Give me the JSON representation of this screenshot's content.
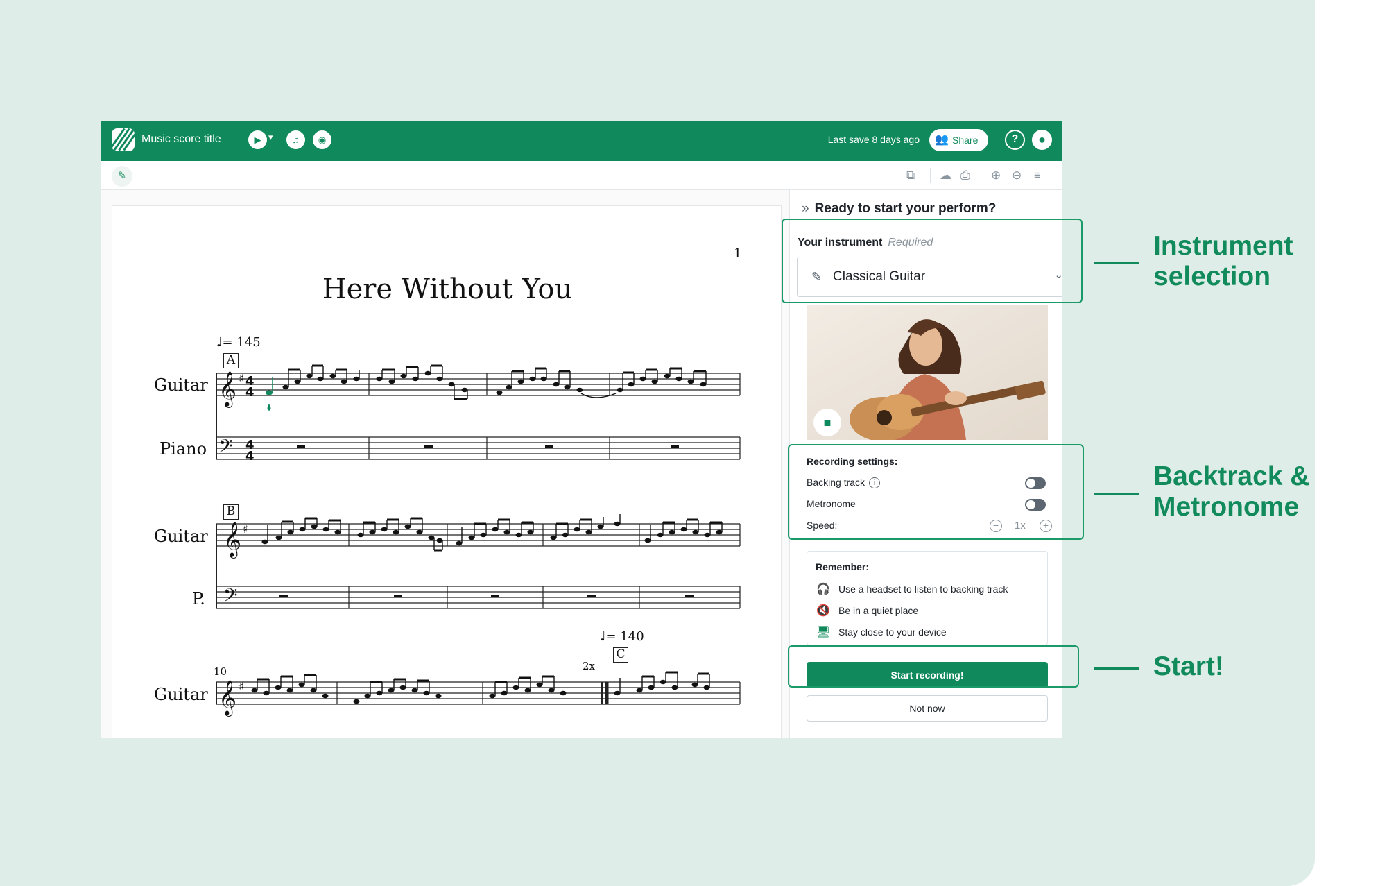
{
  "app": {
    "score_title": "Music score title",
    "last_save": "Last save 8 days ago",
    "share_label": "Share"
  },
  "score": {
    "page_number": "1",
    "song_title": "Here Without You",
    "tempo_1": "= 145",
    "tempo_2": "= 140",
    "rehearsal_a": "A",
    "rehearsal_b": "B",
    "rehearsal_c": "C",
    "instrument_guitar": "Guitar",
    "instrument_piano": "Piano",
    "instrument_piano_short": "P.",
    "measure_number": "10",
    "repeat_mark": "2x"
  },
  "panel": {
    "heading": "Ready to start your perform?",
    "instrument_label": "Your instrument",
    "required_label": "Required",
    "selected_instrument": "Classical Guitar",
    "settings_title": "Recording settings:",
    "backing_track": "Backing track",
    "metronome": "Metronome",
    "speed": "Speed:",
    "speed_value": "1x",
    "backing_track_on": false,
    "metronome_on": false,
    "remember_title": "Remember:",
    "remember_items": [
      "Use a headset to listen to backing track",
      "Be in a quiet place",
      "Stay close to your device"
    ],
    "start_label": "Start recording!",
    "not_now_label": "Not now"
  },
  "callouts": {
    "instrument_line1": "Instrument",
    "instrument_line2": "selection",
    "backtrack_line1": "Backtrack &",
    "backtrack_line2": "Metronome",
    "start": "Start!"
  },
  "colors": {
    "brand": "#108a5c",
    "background": "#deede8"
  }
}
